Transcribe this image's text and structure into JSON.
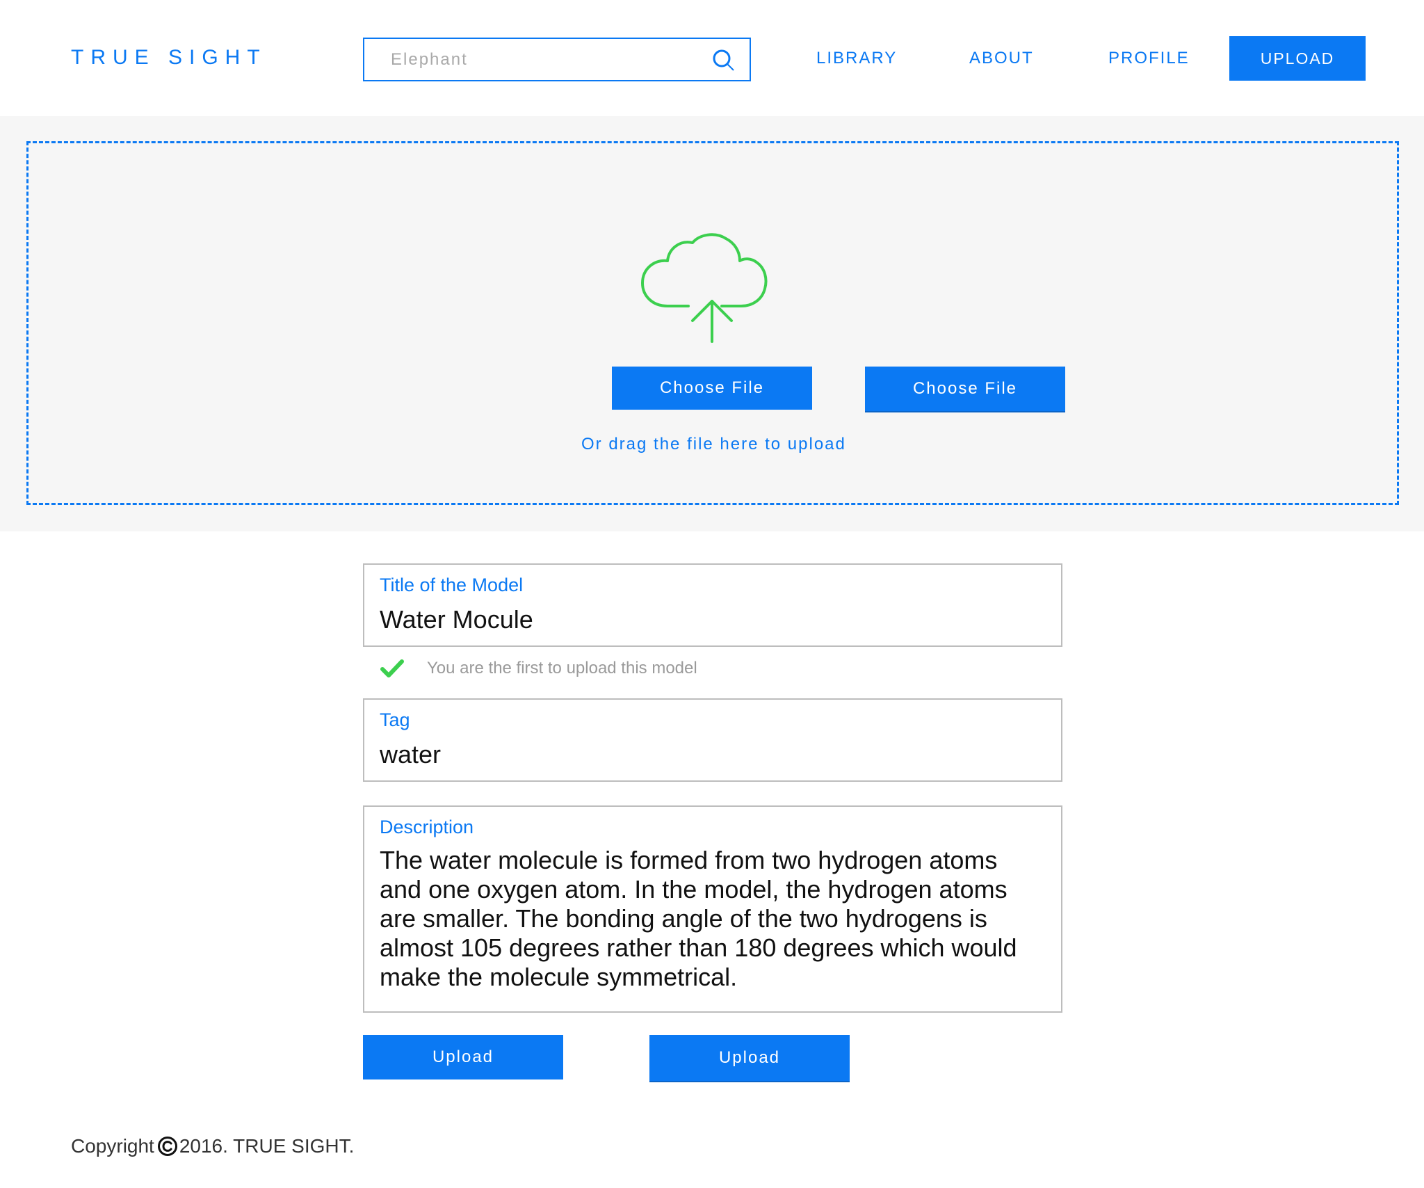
{
  "header": {
    "logo": "TRUE SIGHT",
    "search": {
      "value": "",
      "placeholder": "Elephant"
    },
    "nav": {
      "library": "LIBRARY",
      "about": "ABOUT",
      "profile": "PROFILE",
      "upload": "UPLOAD"
    }
  },
  "dropzone": {
    "icon": "cloud-upload-icon",
    "choose_file_1": "Choose File",
    "choose_file_2": "Choose File",
    "drag_hint": "Or drag the file here to upload"
  },
  "form": {
    "title": {
      "label": "Title of the Model",
      "value": "Water Mocule"
    },
    "uniqueness_hint": "You are the first to upload this model",
    "tag": {
      "label": "Tag",
      "value": "water"
    },
    "description": {
      "label": "Description",
      "value": "The water molecule is formed from two hydrogen atoms and one oxygen atom. In the model, the hydrogen atoms are smaller. The bonding angle of the two hydrogens is almost 105 degrees rather than 180 degrees which would make the molecule symmetrical."
    },
    "upload_1": "Upload",
    "upload_2": "Upload"
  },
  "footer": {
    "copyright_prefix": "Copyright",
    "copyright_suffix": "2016. TRUE SIGHT."
  },
  "colors": {
    "accent": "#0b79f3",
    "success": "#3ccf4e",
    "band": "#f6f6f6"
  }
}
